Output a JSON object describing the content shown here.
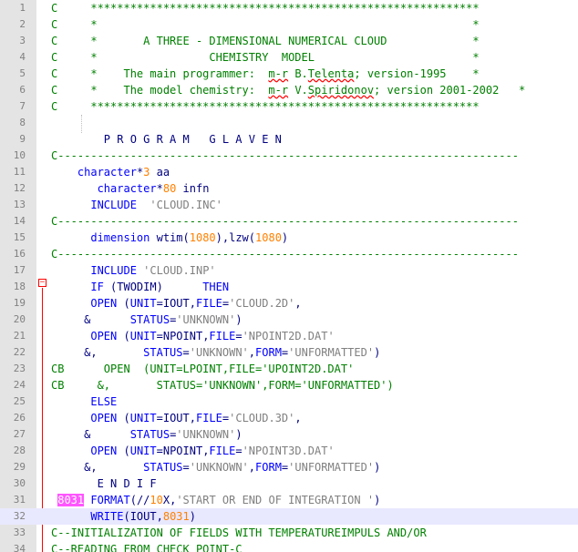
{
  "editor": {
    "lines": [
      {
        "n": "1",
        "tokens": [
          [
            "cmt",
            "C     ***********************************************************"
          ]
        ]
      },
      {
        "n": "2",
        "tokens": [
          [
            "cmt",
            "C     *                                                         *"
          ]
        ]
      },
      {
        "n": "3",
        "tokens": [
          [
            "cmt",
            "C     *       A THREE - DIMENSIONAL NUMERICAL CLOUD             *"
          ]
        ]
      },
      {
        "n": "4",
        "tokens": [
          [
            "cmt",
            "C     *                 CHEMISTRY  MODEL                        *"
          ]
        ]
      },
      {
        "n": "5",
        "tokens": [
          [
            "cmt",
            "C     *    The main programmer:  "
          ],
          [
            "cmt squig",
            "m-r"
          ],
          [
            "cmt",
            " B."
          ],
          [
            "cmt squig",
            "Telenta"
          ],
          [
            "cmt",
            "; version-1995    *"
          ]
        ]
      },
      {
        "n": "6",
        "tokens": [
          [
            "cmt",
            "C     *    The model chemistry:  "
          ],
          [
            "cmt squig",
            "m-r"
          ],
          [
            "cmt",
            " V."
          ],
          [
            "cmt squig",
            "Spiridonov"
          ],
          [
            "cmt",
            "; version 2001-2002   *"
          ]
        ]
      },
      {
        "n": "7",
        "tokens": [
          [
            "cmt",
            "C     ***********************************************************"
          ]
        ]
      },
      {
        "n": "8",
        "tokens": []
      },
      {
        "n": "9",
        "tokens": [
          [
            "plain",
            "        P R O G R A M   G L A V E N"
          ]
        ]
      },
      {
        "n": "10",
        "tokens": [
          [
            "cmt",
            "C----------------------------------------------------------------------"
          ]
        ]
      },
      {
        "n": "11",
        "tokens": [
          [
            "plain",
            "    "
          ],
          [
            "kw",
            "character"
          ],
          [
            "plain",
            "*"
          ],
          [
            "num",
            "3"
          ],
          [
            "plain",
            " aa"
          ]
        ]
      },
      {
        "n": "12",
        "tokens": [
          [
            "plain",
            "       "
          ],
          [
            "kw",
            "character"
          ],
          [
            "plain",
            "*"
          ],
          [
            "num",
            "80"
          ],
          [
            "plain",
            " infn"
          ]
        ]
      },
      {
        "n": "13",
        "tokens": [
          [
            "plain",
            "      "
          ],
          [
            "kw",
            "INCLUDE"
          ],
          [
            "plain",
            "  "
          ],
          [
            "str",
            "'CLOUD.INC'"
          ]
        ]
      },
      {
        "n": "14",
        "tokens": [
          [
            "cmt",
            "C----------------------------------------------------------------------"
          ]
        ]
      },
      {
        "n": "15",
        "tokens": [
          [
            "plain",
            "      "
          ],
          [
            "kw",
            "dimension"
          ],
          [
            "plain",
            " wtim("
          ],
          [
            "num",
            "1080"
          ],
          [
            "plain",
            "),lzw("
          ],
          [
            "num",
            "1080"
          ],
          [
            "plain",
            ")"
          ]
        ]
      },
      {
        "n": "16",
        "tokens": [
          [
            "cmt",
            "C----------------------------------------------------------------------"
          ]
        ]
      },
      {
        "n": "17",
        "tokens": [
          [
            "plain",
            "      "
          ],
          [
            "kw",
            "INCLUDE"
          ],
          [
            "plain",
            " "
          ],
          [
            "str",
            "'CLOUD.INP'"
          ]
        ]
      },
      {
        "n": "18",
        "tokens": [
          [
            "plain",
            "      "
          ],
          [
            "kw",
            "IF"
          ],
          [
            "plain",
            " (TWODIM)      "
          ],
          [
            "kw",
            "THEN"
          ]
        ]
      },
      {
        "n": "19",
        "tokens": [
          [
            "plain",
            "      "
          ],
          [
            "kw",
            "OPEN"
          ],
          [
            "plain",
            " ("
          ],
          [
            "kw",
            "UNIT"
          ],
          [
            "plain",
            "=IOUT,"
          ],
          [
            "kw",
            "FILE"
          ],
          [
            "plain",
            "="
          ],
          [
            "str",
            "'CLOUD.2D'"
          ],
          [
            "plain",
            ","
          ]
        ]
      },
      {
        "n": "20",
        "tokens": [
          [
            "plain",
            "     &      "
          ],
          [
            "kw",
            "STATUS"
          ],
          [
            "plain",
            "="
          ],
          [
            "str",
            "'UNKNOWN'"
          ],
          [
            "plain",
            ")"
          ]
        ]
      },
      {
        "n": "21",
        "tokens": [
          [
            "plain",
            "      "
          ],
          [
            "kw",
            "OPEN"
          ],
          [
            "plain",
            " ("
          ],
          [
            "kw",
            "UNIT"
          ],
          [
            "plain",
            "=NPOINT,"
          ],
          [
            "kw",
            "FILE"
          ],
          [
            "plain",
            "="
          ],
          [
            "str",
            "'NPOINT2D.DAT'"
          ]
        ]
      },
      {
        "n": "22",
        "tokens": [
          [
            "plain",
            "     &,       "
          ],
          [
            "kw",
            "STATUS"
          ],
          [
            "plain",
            "="
          ],
          [
            "str",
            "'UNKNOWN'"
          ],
          [
            "plain",
            ","
          ],
          [
            "kw",
            "FORM"
          ],
          [
            "plain",
            "="
          ],
          [
            "str",
            "'UNFORMATTED'"
          ],
          [
            "plain",
            ")"
          ]
        ]
      },
      {
        "n": "23",
        "tokens": [
          [
            "cmt",
            "CB      OPEN  (UNIT=LPOINT,FILE='UPOINT2D.DAT'"
          ]
        ]
      },
      {
        "n": "24",
        "tokens": [
          [
            "cmt",
            "CB     &,       STATUS='UNKNOWN',FORM='UNFORMATTED')"
          ]
        ]
      },
      {
        "n": "25",
        "tokens": [
          [
            "plain",
            "      "
          ],
          [
            "kw",
            "ELSE"
          ]
        ]
      },
      {
        "n": "26",
        "tokens": [
          [
            "plain",
            "      "
          ],
          [
            "kw",
            "OPEN"
          ],
          [
            "plain",
            " ("
          ],
          [
            "kw",
            "UNIT"
          ],
          [
            "plain",
            "=IOUT,"
          ],
          [
            "kw",
            "FILE"
          ],
          [
            "plain",
            "="
          ],
          [
            "str",
            "'CLOUD.3D'"
          ],
          [
            "plain",
            ","
          ]
        ]
      },
      {
        "n": "27",
        "tokens": [
          [
            "plain",
            "     &      "
          ],
          [
            "kw",
            "STATUS"
          ],
          [
            "plain",
            "="
          ],
          [
            "str",
            "'UNKNOWN'"
          ],
          [
            "plain",
            ")"
          ]
        ]
      },
      {
        "n": "28",
        "tokens": [
          [
            "plain",
            "      "
          ],
          [
            "kw",
            "OPEN"
          ],
          [
            "plain",
            " ("
          ],
          [
            "kw",
            "UNIT"
          ],
          [
            "plain",
            "=NPOINT,"
          ],
          [
            "kw",
            "FILE"
          ],
          [
            "plain",
            "="
          ],
          [
            "str",
            "'NPOINT3D.DAT'"
          ]
        ]
      },
      {
        "n": "29",
        "tokens": [
          [
            "plain",
            "     &,       "
          ],
          [
            "kw",
            "STATUS"
          ],
          [
            "plain",
            "="
          ],
          [
            "str",
            "'UNKNOWN'"
          ],
          [
            "plain",
            ","
          ],
          [
            "kw",
            "FORM"
          ],
          [
            "plain",
            "="
          ],
          [
            "str",
            "'UNFORMATTED'"
          ],
          [
            "plain",
            ")"
          ]
        ]
      },
      {
        "n": "30",
        "tokens": [
          [
            "plain",
            "       E N D I F"
          ]
        ]
      },
      {
        "n": "31",
        "tokens": [
          [
            "plain",
            " "
          ],
          [
            "hl-label",
            "8031"
          ],
          [
            "plain",
            " "
          ],
          [
            "kw",
            "FORMAT"
          ],
          [
            "plain",
            "(//"
          ],
          [
            "num",
            "10"
          ],
          [
            "plain",
            "X,"
          ],
          [
            "str",
            "'START OR END OF INTEGRATION '"
          ],
          [
            "plain",
            ")"
          ]
        ]
      },
      {
        "n": "32",
        "tokens": [
          [
            "plain",
            "      "
          ],
          [
            "kw",
            "WRITE"
          ],
          [
            "plain",
            "(IOUT,"
          ],
          [
            "num",
            "8031"
          ],
          [
            "plain",
            ")"
          ]
        ]
      },
      {
        "n": "33",
        "tokens": [
          [
            "cmt",
            "C--INITIALIZATION OF FIELDS WITH TEMPERATUREIMPULS AND/OR"
          ]
        ]
      },
      {
        "n": "34",
        "tokens": [
          [
            "cmt",
            "C--READING FROM CHECK POINT-C"
          ]
        ]
      }
    ],
    "current_line": "32",
    "fold_marker_symbol": "−"
  }
}
